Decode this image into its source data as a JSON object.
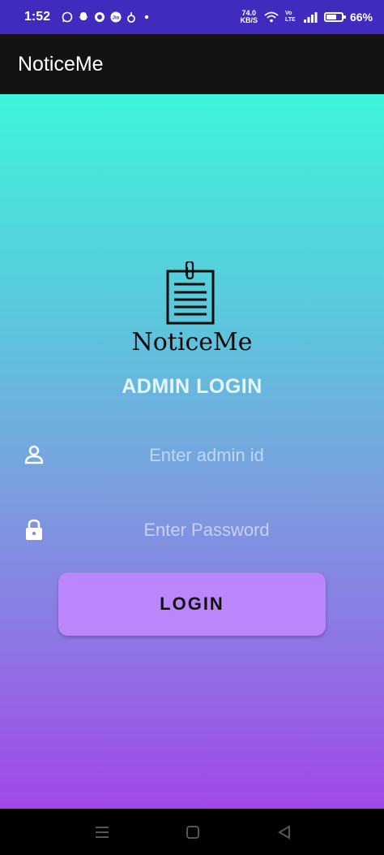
{
  "status_bar": {
    "time": "1:52",
    "net_speed_value": "74.0",
    "net_speed_unit": "KB/S",
    "volte": "Vo LTE",
    "battery_percent": "66%",
    "battery_level": 0.66,
    "notification_icons": [
      "whatsapp-icon",
      "snapchat-icon",
      "circle-app-icon",
      "jio-icon",
      "app-icon",
      "dot-icon"
    ]
  },
  "app_bar": {
    "title": "NoticeMe"
  },
  "login": {
    "brand": "NoticeMe",
    "heading": "ADMIN LOGIN",
    "admin_id_placeholder": "Enter admin id",
    "password_placeholder": "Enter Password",
    "button_label": "LOGIN"
  },
  "colors": {
    "status_bar": "#3f2bbd",
    "app_bar": "#131313",
    "gradient_top": "#3ff3dc",
    "gradient_bottom": "#a148e8",
    "button": "#bb86fc"
  }
}
